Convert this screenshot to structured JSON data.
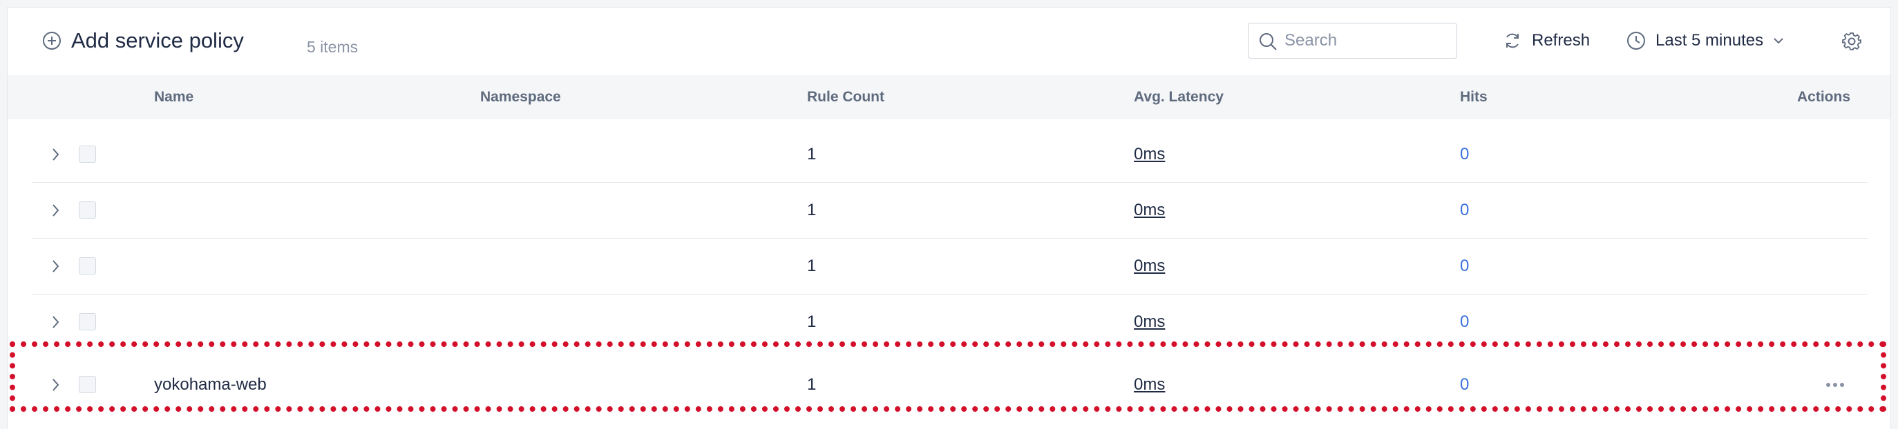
{
  "toolbar": {
    "add_label": "Add service policy",
    "add_icon": "plus-circle-icon",
    "item_count": "5 items",
    "search_placeholder": "Search",
    "search_value": "",
    "refresh_label": "Refresh",
    "time_range_label": "Last 5 minutes",
    "settings_icon": "gear-icon"
  },
  "table": {
    "columns": {
      "name": "Name",
      "namespace": "Namespace",
      "rule_count": "Rule Count",
      "avg_latency": "Avg. Latency",
      "hits": "Hits",
      "actions": "Actions"
    },
    "rows": [
      {
        "name": "",
        "namespace": "",
        "rule_count": "1",
        "avg_latency": "0ms",
        "hits": "0",
        "has_actions": false
      },
      {
        "name": "",
        "namespace": "",
        "rule_count": "1",
        "avg_latency": "0ms",
        "hits": "0",
        "has_actions": false
      },
      {
        "name": "",
        "namespace": "",
        "rule_count": "1",
        "avg_latency": "0ms",
        "hits": "0",
        "has_actions": false
      },
      {
        "name": "",
        "namespace": "",
        "rule_count": "1",
        "avg_latency": "0ms",
        "hits": "0",
        "has_actions": false
      },
      {
        "name": "yokohama-web",
        "namespace": "",
        "rule_count": "1",
        "avg_latency": "0ms",
        "hits": "0",
        "has_actions": true
      }
    ]
  },
  "colors": {
    "highlight": "#d40f2a",
    "link": "#3b6fe0",
    "header_bg": "#f5f6f8"
  }
}
